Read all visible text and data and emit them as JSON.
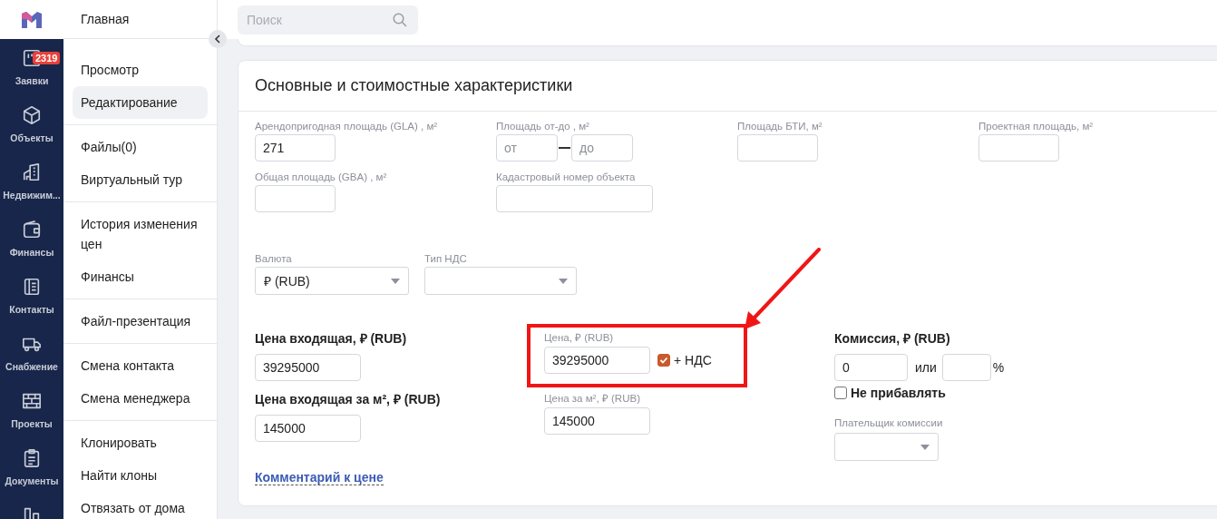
{
  "rail": {
    "items": [
      {
        "kind": "labeled",
        "label": "Заявки",
        "badge": "2319"
      },
      {
        "kind": "labeled",
        "label": "Объекты"
      },
      {
        "kind": "labeled",
        "label": "Недвижим..."
      },
      {
        "kind": "labeled",
        "label": "Финансы"
      },
      {
        "kind": "labeled",
        "label": "Контакты"
      },
      {
        "kind": "labeled",
        "label": "Снабжение"
      },
      {
        "kind": "labeled",
        "label": "Проекты"
      },
      {
        "kind": "labeled",
        "label": "Документы"
      },
      {
        "kind": "icon_only"
      }
    ]
  },
  "submenu": {
    "title": "Главная",
    "groups": [
      [
        {
          "label": "Просмотр",
          "selected": false
        },
        {
          "label": "Редактирование",
          "selected": true
        }
      ],
      [
        {
          "label": "Файлы(0)",
          "selected": false
        },
        {
          "label": "Виртуальный тур",
          "selected": false
        }
      ],
      [
        {
          "label": "История изменения цен",
          "selected": false
        },
        {
          "label": "Финансы",
          "selected": false
        }
      ],
      [
        {
          "label": "Файл-презентация",
          "selected": false
        }
      ],
      [
        {
          "label": "Смена контакта",
          "selected": false
        },
        {
          "label": "Смена менеджера",
          "selected": false
        }
      ],
      [
        {
          "label": "Клонировать",
          "selected": false
        },
        {
          "label": "Найти клоны",
          "selected": false
        },
        {
          "label": "Отвязать от дома",
          "selected": false
        }
      ]
    ]
  },
  "search": {
    "placeholder": "Поиск"
  },
  "section": {
    "title": "Основные и стоимостные характеристики",
    "area_fields": [
      {
        "kind": "single",
        "label": "Арендопригодная площадь (GLA) , м²",
        "value": "271"
      },
      {
        "kind": "range",
        "label": "Площадь от-до , м²",
        "from_placeholder": "от",
        "to_placeholder": "до"
      },
      {
        "kind": "single",
        "label": "Площадь БТИ, м²"
      },
      {
        "kind": "single",
        "label": "Проектная площадь, м²"
      },
      {
        "kind": "single",
        "label": "Общая площадь (GBA) , м²"
      },
      {
        "kind": "wide",
        "label": "Кадастровый номер объекта"
      }
    ],
    "selects": [
      {
        "label": "Валюта",
        "value": "₽ (RUB)"
      },
      {
        "label": "Тип НДС"
      }
    ],
    "incoming_price": {
      "label": "Цена входящая, ₽ (RUB)",
      "value": "39295000"
    },
    "incoming_price_per_m2": {
      "label": "Цена входящая за м², ₽ (RUB)",
      "value": "145000"
    },
    "comment_link": "Комментарий к цене",
    "price": {
      "label": "Цена, ₽ (RUB)",
      "value": "39295000",
      "vat_label": "+ НДС",
      "vat_checked": true,
      "highlighted": true
    },
    "price_per_m2": {
      "label": "Цена за м², ₽ (RUB)",
      "value": "145000"
    },
    "commission": {
      "label": "Комиссия, ₽ (RUB)",
      "amount": "0",
      "or_label": "или",
      "percent_sign": "%",
      "no_add_label": "Не прибавлять",
      "no_add_checked": false,
      "payer_label": "Плательщик комиссии"
    }
  }
}
